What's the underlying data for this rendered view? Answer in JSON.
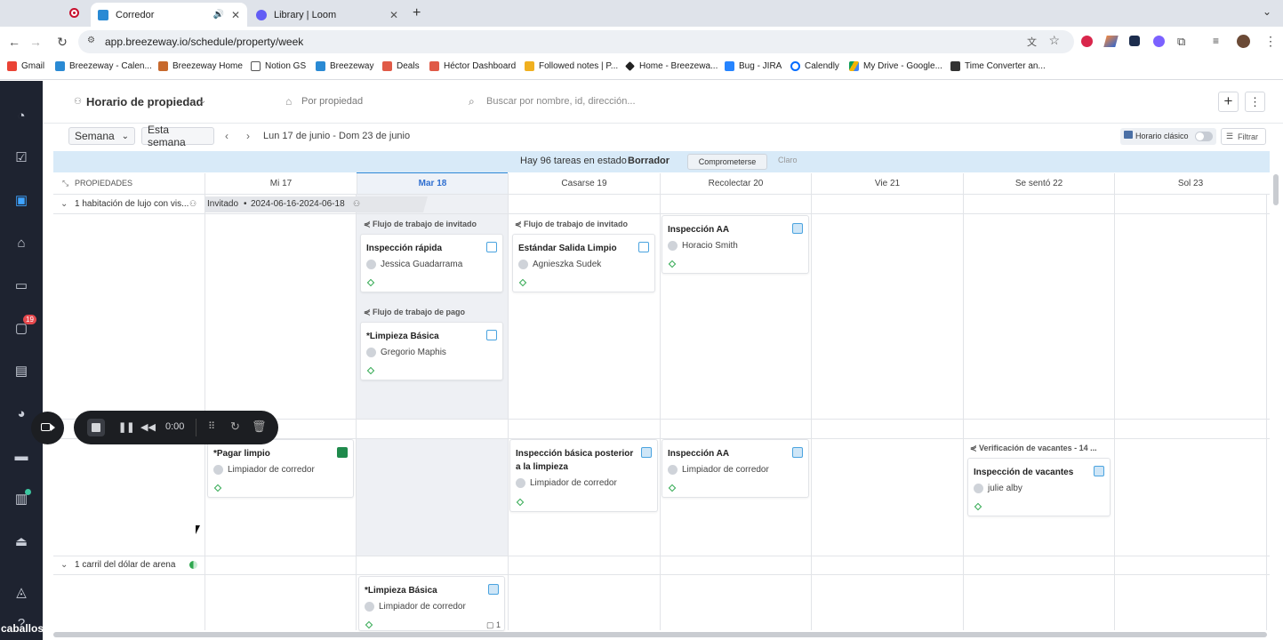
{
  "browser": {
    "tabs": [
      {
        "label": "Corredor",
        "active": true
      },
      {
        "label": "Library | Loom",
        "active": false
      }
    ],
    "url": "app.breezeway.io/schedule/property/week",
    "bookmarks": [
      "Gmail",
      "Breezeway - Calen...",
      "Breezeway Home",
      "Notion GS",
      "Breezeway",
      "Deals",
      "Héctor Dashboard",
      "Followed notes | P...",
      "Home - Breezewa...",
      "Bug - JIRA",
      "Calendly",
      "My Drive - Google...",
      "Time Converter an..."
    ]
  },
  "sidebar": {
    "icons": [
      "dashboard-icon",
      "tasks-icon",
      "calendar-icon",
      "home-icon",
      "bed-icon",
      "chat-icon",
      "book-icon",
      "chart-icon",
      "card-icon",
      "bag-icon",
      "bell-service-icon",
      "bell-icon",
      "help-icon"
    ],
    "chat_badge": "19",
    "bottom_label": "caballos"
  },
  "header": {
    "title": "Horario de propiedad",
    "view": "Por propiedad",
    "search_placeholder": "Buscar por nombre, id, dirección..."
  },
  "toolbar": {
    "range_select": "Semana",
    "this_week": "Esta semana",
    "date_range": "Lun 17 de junio - Dom 23 de junio",
    "classic_label": "Horario clásico",
    "filter_label": "Filtrar"
  },
  "banner": {
    "text": "Hay 96 tareas en estado",
    "status": "Borrador",
    "commit": "Comprometerse",
    "clear": "Claro"
  },
  "grid": {
    "properties_header": "PROPIEDADES",
    "days": [
      "Mi 17",
      "Mar 18",
      "Casarse 19",
      "Recolectar 20",
      "Vie 21",
      "Se sentó 22",
      "Sol 23"
    ],
    "today_index": 1,
    "rows": [
      {
        "label": "1 habitación de lujo con vis..."
      },
      {
        "label": ""
      },
      {
        "label": "1 carril del dólar de arena"
      }
    ],
    "reservation": {
      "status": "Invitado",
      "dates": "2024-06-16-2024-06-18"
    }
  },
  "cards": [
    {
      "flow": "Flujo de trabajo de invitado",
      "title": "Inspección rápida",
      "person": "Jessica Guadarrama"
    },
    {
      "flow": "Flujo de trabajo de pago",
      "title": "*Limpieza Básica",
      "person": "Gregorio Maphis"
    },
    {
      "flow": "Flujo de trabajo de invitado",
      "title": "Estándar Salida Limpio",
      "person": "Agnieszka Sudek"
    },
    {
      "title": "Inspección AA",
      "person": "Horacio Smith"
    },
    {
      "title": "*Pagar limpio",
      "person": "Limpiador de corredor"
    },
    {
      "title": "Inspección básica posterior a la limpieza",
      "person": "Limpiador de corredor"
    },
    {
      "title": "Inspección AA",
      "person": "Limpiador de corredor"
    },
    {
      "flow": "Verificación de vacantes - 14 ...",
      "title": "Inspección de vacantes",
      "person": "julie alby"
    },
    {
      "title": "*Limpieza Básica",
      "person": "Limpiador de corredor",
      "comments": "1"
    }
  ],
  "recorder": {
    "time": "0:00"
  }
}
